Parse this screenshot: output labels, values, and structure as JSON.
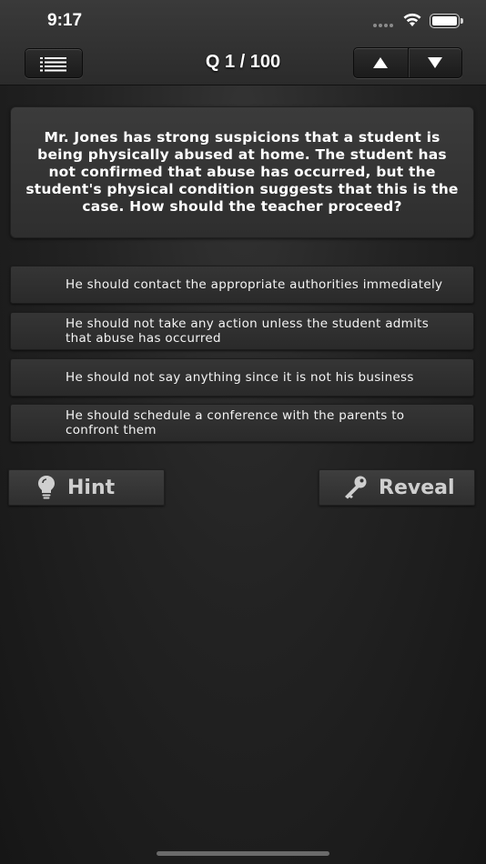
{
  "status_bar": {
    "time": "9:17"
  },
  "nav": {
    "menu_icon": "list-icon",
    "counter": "Q 1 / 100",
    "prev_icon": "arrow-up-icon",
    "next_icon": "arrow-down-icon"
  },
  "question": {
    "text": "Mr. Jones has strong suspicions that a student is being physically abused at home. The student has not confirmed that abuse has occurred, but the student's physical condition suggests that this is the case. How should the teacher proceed?"
  },
  "answers": [
    {
      "text": "He should contact the appropriate authorities immediately"
    },
    {
      "text": "He should not take any action unless the student admits that abuse has occurred"
    },
    {
      "text": "He should not say anything since it is not his business"
    },
    {
      "text": "He should schedule a conference with the parents to confront them"
    }
  ],
  "actions": {
    "hint_label": "Hint",
    "hint_icon": "lightbulb-icon",
    "reveal_label": "Reveal",
    "reveal_icon": "key-icon"
  },
  "colors": {
    "background": "#1a1a1a",
    "card": "#353535",
    "text": "#ffffff",
    "button_text": "#cfcfcf"
  }
}
